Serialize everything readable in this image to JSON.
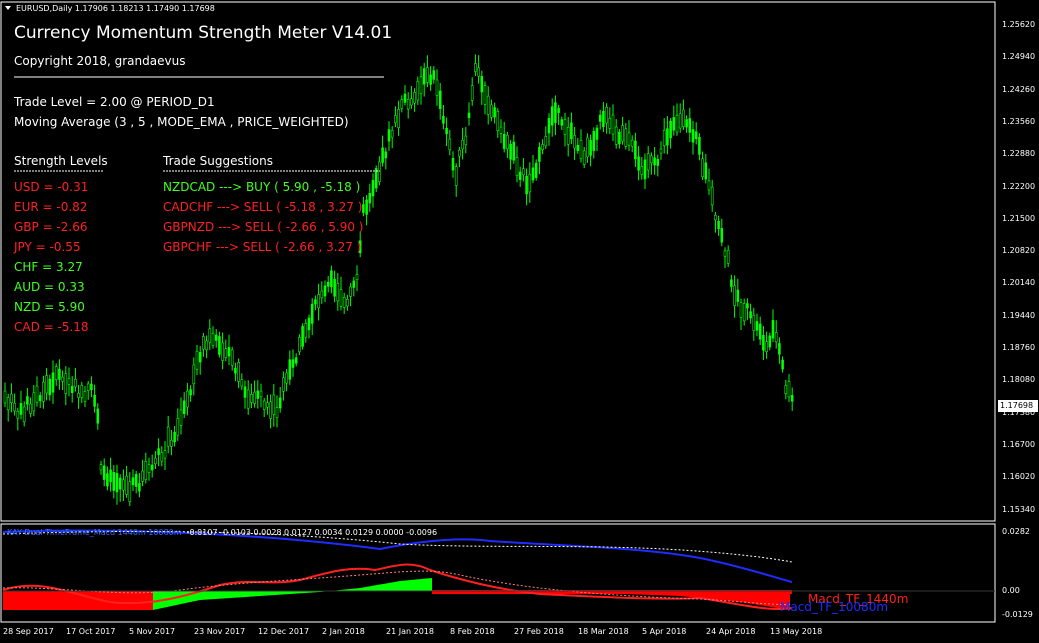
{
  "header": {
    "symbol_info": "EURUSD,Daily  1.17906 1.18213 1.17490 1.17698"
  },
  "panel": {
    "title": "Currency Momentum Strength Meter V14.01",
    "copyright": "Copyright 2018, grandaevus",
    "trade_level": "Trade Level = 2.00 @ PERIOD_D1",
    "moving_average": "Moving Average (3 , 5 , MODE_EMA , PRICE_WEIGHTED)",
    "strength_header": "Strength Levels",
    "suggest_header": "Trade Suggestions",
    "strength": [
      {
        "text": "USD = -0.31",
        "color": "#ff2020"
      },
      {
        "text": "EUR = -0.82",
        "color": "#ff2020"
      },
      {
        "text": "GBP = -2.66",
        "color": "#ff2020"
      },
      {
        "text": "JPY = -0.55",
        "color": "#ff2020"
      },
      {
        "text": "CHF = 3.27",
        "color": "#40ff20"
      },
      {
        "text": "AUD = 0.33",
        "color": "#40ff20"
      },
      {
        "text": "NZD = 5.90",
        "color": "#40ff20"
      },
      {
        "text": "CAD = -5.18",
        "color": "#ff2020"
      }
    ],
    "suggestions": [
      {
        "text": "NZDCAD ---> BUY ( 5.90 , -5.18 )",
        "color": "#40ff20"
      },
      {
        "text": "CADCHF ---> SELL ( -5.18 , 3.27 )",
        "color": "#ff2020"
      },
      {
        "text": "GBPNZD ---> SELL ( -2.66 , 5.90 )",
        "color": "#ff2020"
      },
      {
        "text": "GBPCHF ---> SELL ( -2.66 , 3.27 )",
        "color": "#ff2020"
      }
    ]
  },
  "price_axis": [
    "1.25620",
    "1.24940",
    "1.24260",
    "1.23560",
    "1.22880",
    "1.22200",
    "1.21500",
    "1.20820",
    "1.20140",
    "1.19440",
    "1.18760",
    "1.18080",
    "1.17380",
    "1.16700",
    "1.16020",
    "1.15340"
  ],
  "current_price": "1.17698",
  "indicator": {
    "name": "KAY Dual TimeFrame_Macd 1440m 10080m",
    "values": "-0.0107 -0.0103 0.0028 0.0127 0.0034 0.0129 0.0000 -0.0096",
    "axis": [
      "0.0282",
      "0.00",
      "-0.0129"
    ],
    "label_1440": "Macd_TF_1440m",
    "label_10080": "Macd_TF_10080m"
  },
  "date_axis": [
    "28 Sep 2017",
    "17 Oct 2017",
    "5 Nov 2017",
    "23 Nov 2017",
    "12 Dec 2017",
    "2 Jan 2018",
    "21 Jan 2018",
    "8 Feb 2018",
    "27 Feb 2018",
    "18 Mar 2018",
    "5 Apr 2018",
    "24 Apr 2018",
    "13 May 2018"
  ],
  "colors": {
    "bull": "#00ff00",
    "hist_neg": "#ff0000",
    "hist_pos": "#00ff00",
    "macd_slow": "#1e2cff",
    "macd_fast": "#ff2020",
    "signal_dots": "#ffffff"
  }
}
